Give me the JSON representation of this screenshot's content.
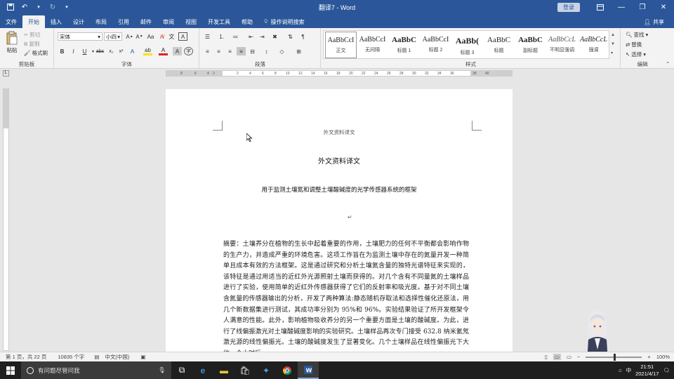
{
  "window": {
    "title": "翻译7 - Word",
    "login_label": "登录",
    "share_label": "共享"
  },
  "tabs": [
    {
      "label": "文件"
    },
    {
      "label": "开始",
      "active": true
    },
    {
      "label": "插入"
    },
    {
      "label": "设计"
    },
    {
      "label": "布局"
    },
    {
      "label": "引用"
    },
    {
      "label": "邮件"
    },
    {
      "label": "审阅"
    },
    {
      "label": "视图"
    },
    {
      "label": "开发工具"
    },
    {
      "label": "帮助"
    }
  ],
  "tell_me": "操作说明搜索",
  "clipboard": {
    "paste": "粘贴",
    "cut": "剪切",
    "copy": "复制",
    "format_painter": "格式刷",
    "label": "剪贴板"
  },
  "font": {
    "name": "宋体",
    "size": "小四",
    "label": "字体"
  },
  "paragraph": {
    "label": "段落"
  },
  "styles": {
    "label": "样式",
    "items": [
      {
        "sample": "AaBbCcI",
        "name": "正文"
      },
      {
        "sample": "AaBbCcI",
        "name": "无间隔"
      },
      {
        "sample": "AaBbC",
        "name": "标题 1"
      },
      {
        "sample": "AaBbCcI",
        "name": "标题 2"
      },
      {
        "sample": "AaBb(",
        "name": "标题 3"
      },
      {
        "sample": "AaBbC",
        "name": "标题"
      },
      {
        "sample": "AaBbC",
        "name": "副标题"
      },
      {
        "sample": "AaBbCcL",
        "name": "不明显强调"
      },
      {
        "sample": "AaBbCcL",
        "name": "强调"
      }
    ]
  },
  "editing": {
    "find": "查找",
    "replace": "替换",
    "select": "选择",
    "label": "编辑"
  },
  "ruler_ticks": [
    "8",
    "6",
    "4",
    "2",
    "2",
    "4",
    "6",
    "8",
    "10",
    "12",
    "14",
    "16",
    "18",
    "20",
    "22",
    "24",
    "26",
    "28",
    "30",
    "32",
    "34",
    "36",
    "38",
    "40"
  ],
  "document": {
    "header": "外文资料译文",
    "title": "外文资料译文",
    "subtitle": "用于监测土壤氮和调整土壤酸碱度的光学传感器系统的框架",
    "para_mark": "↵",
    "body": "摘要：土壤养分在植物的生长中起着重要的作用，土壤肥力的任何不平衡都会影响作物的生产力，并造成严重的环境危害。这项工作旨在为监测土壤中存在的氮量开发一种简单且成本有效的方法框架。这是通过研究和分析土壤氮含量的独特光谱特征来实现的，该特征是通过用适当的近红外光源照射土壤而获得的。对几个含有不同量氮的土壤样品进行了实验，使用简单的近红外传感器获得了它们的反射率和吸光度。基于对不同土壤含氮量的传感器输出的分析，开发了两种算法:静态随机存取法和选择性催化还原法，用几个新数据集进行测试，其成功率分别为 95%和 96%。实验结果验证了所开发框架令人满意的性能。此外，影响植物吸收养分的另一个重要方面是土壤的酸碱度。为此，进行了线偏振激光对土壤酸碱度影响的实验研究。土壤样品再次专门接受 632.8 纳米氦氖激光源的线性偏振光。土壤的酸碱度发生了显著变化。几个土壤样品在线性偏振光下大约一个小时后，"
  },
  "status": {
    "page": "第 1 页，共 22 页",
    "words": "10835 个字",
    "language": "中文(中国)",
    "zoom": "100%"
  },
  "taskbar": {
    "search_placeholder": "有问题尽管问我",
    "time": "21:51",
    "date": "2021/4/17",
    "ime": "中"
  },
  "colors": {
    "word_blue": "#2b579a",
    "ribbon_bg": "#f3f3f3"
  }
}
